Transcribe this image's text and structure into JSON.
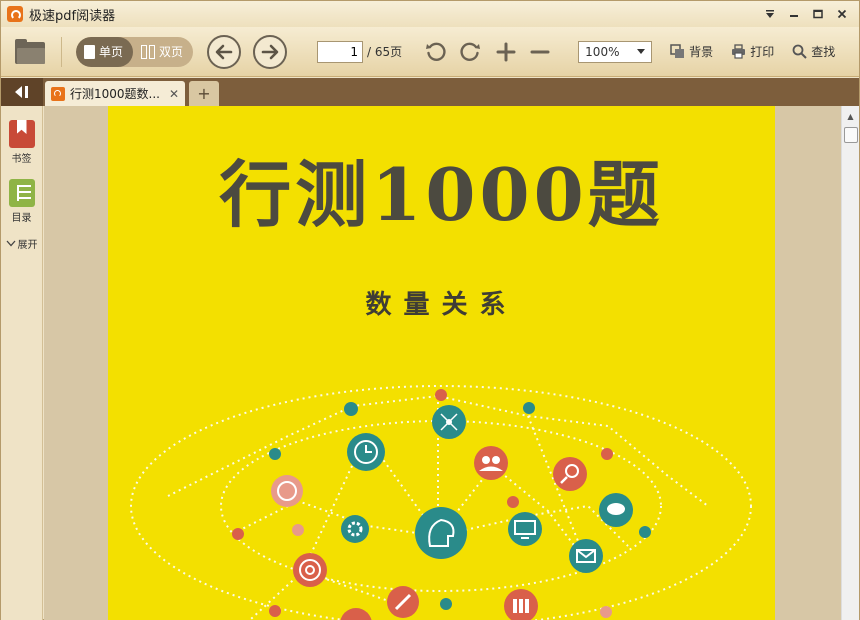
{
  "window": {
    "title": "极速pdf阅读器",
    "controls": [
      "dropdown-icon",
      "minimize-icon",
      "maximize-icon",
      "close-icon"
    ]
  },
  "toolbar": {
    "single_page_label": "单页",
    "double_page_label": "双页",
    "current_page": "1",
    "total_pages": "/ 65页",
    "zoom": "100%",
    "background_label": "背景",
    "print_label": "打印",
    "search_label": "查找"
  },
  "tabs": [
    {
      "label": "行测1000题数...",
      "active": true
    }
  ],
  "left_panel": {
    "bookmark_label": "书签",
    "toc_label": "目录",
    "expand_label": "展开"
  },
  "document": {
    "title": "行测1000题",
    "subtitle": "数量关系"
  },
  "colors": {
    "page_bg": "#f3e000",
    "accent_orange": "#e8731a",
    "teal": "#2a8b8a",
    "coral": "#d9604a"
  }
}
